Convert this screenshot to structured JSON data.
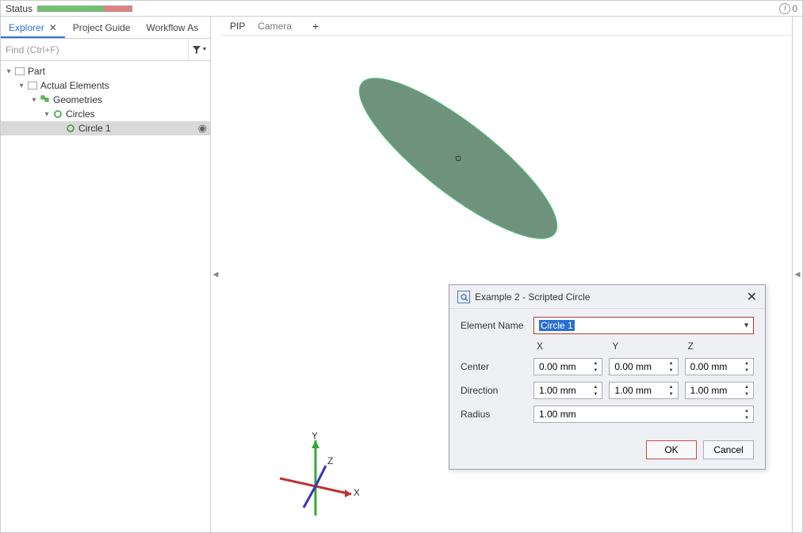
{
  "status": {
    "label": "Status",
    "info_count": "0"
  },
  "left_tabs": {
    "explorer": "Explorer",
    "project_guide": "Project Guide",
    "workflow": "Workflow As"
  },
  "find": {
    "placeholder": "Find (Ctrl+F)"
  },
  "tree": {
    "part": "Part",
    "actual_elements": "Actual Elements",
    "geometries": "Geometries",
    "circles": "Circles",
    "circle1": "Circle 1"
  },
  "view_tabs": {
    "pip": "PIP",
    "camera": "Camera"
  },
  "dialog": {
    "title": "Example 2 - Scripted Circle",
    "element_name_label": "Element Name",
    "element_name_value": "Circle 1",
    "col_x": "X",
    "col_y": "Y",
    "col_z": "Z",
    "center_label": "Center",
    "center_x": "0.00 mm",
    "center_y": "0.00 mm",
    "center_z": "0.00 mm",
    "direction_label": "Direction",
    "direction_x": "1.00 mm",
    "direction_y": "1.00 mm",
    "direction_z": "1.00 mm",
    "radius_label": "Radius",
    "radius_value": "1.00 mm",
    "ok": "OK",
    "cancel": "Cancel"
  },
  "axis": {
    "x": "X",
    "y": "Y",
    "z": "Z"
  }
}
